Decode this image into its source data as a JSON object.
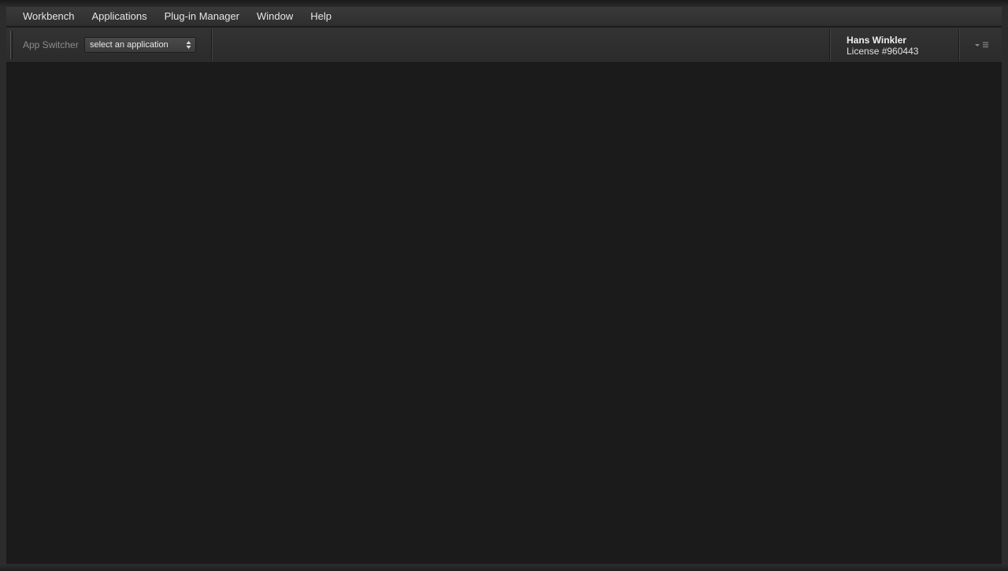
{
  "menubar": {
    "items": [
      {
        "label": "Workbench"
      },
      {
        "label": "Applications"
      },
      {
        "label": "Plug-in Manager"
      },
      {
        "label": "Window"
      },
      {
        "label": "Help"
      }
    ]
  },
  "toolbar": {
    "app_switcher_label": "App Switcher",
    "app_select": {
      "selected": "select an application"
    }
  },
  "user": {
    "name": "Hans Winkler",
    "license": "License #960443"
  },
  "icons": {
    "select_arrows": "up-down-arrows-icon",
    "panel_menu": "panel-menu-icon"
  }
}
